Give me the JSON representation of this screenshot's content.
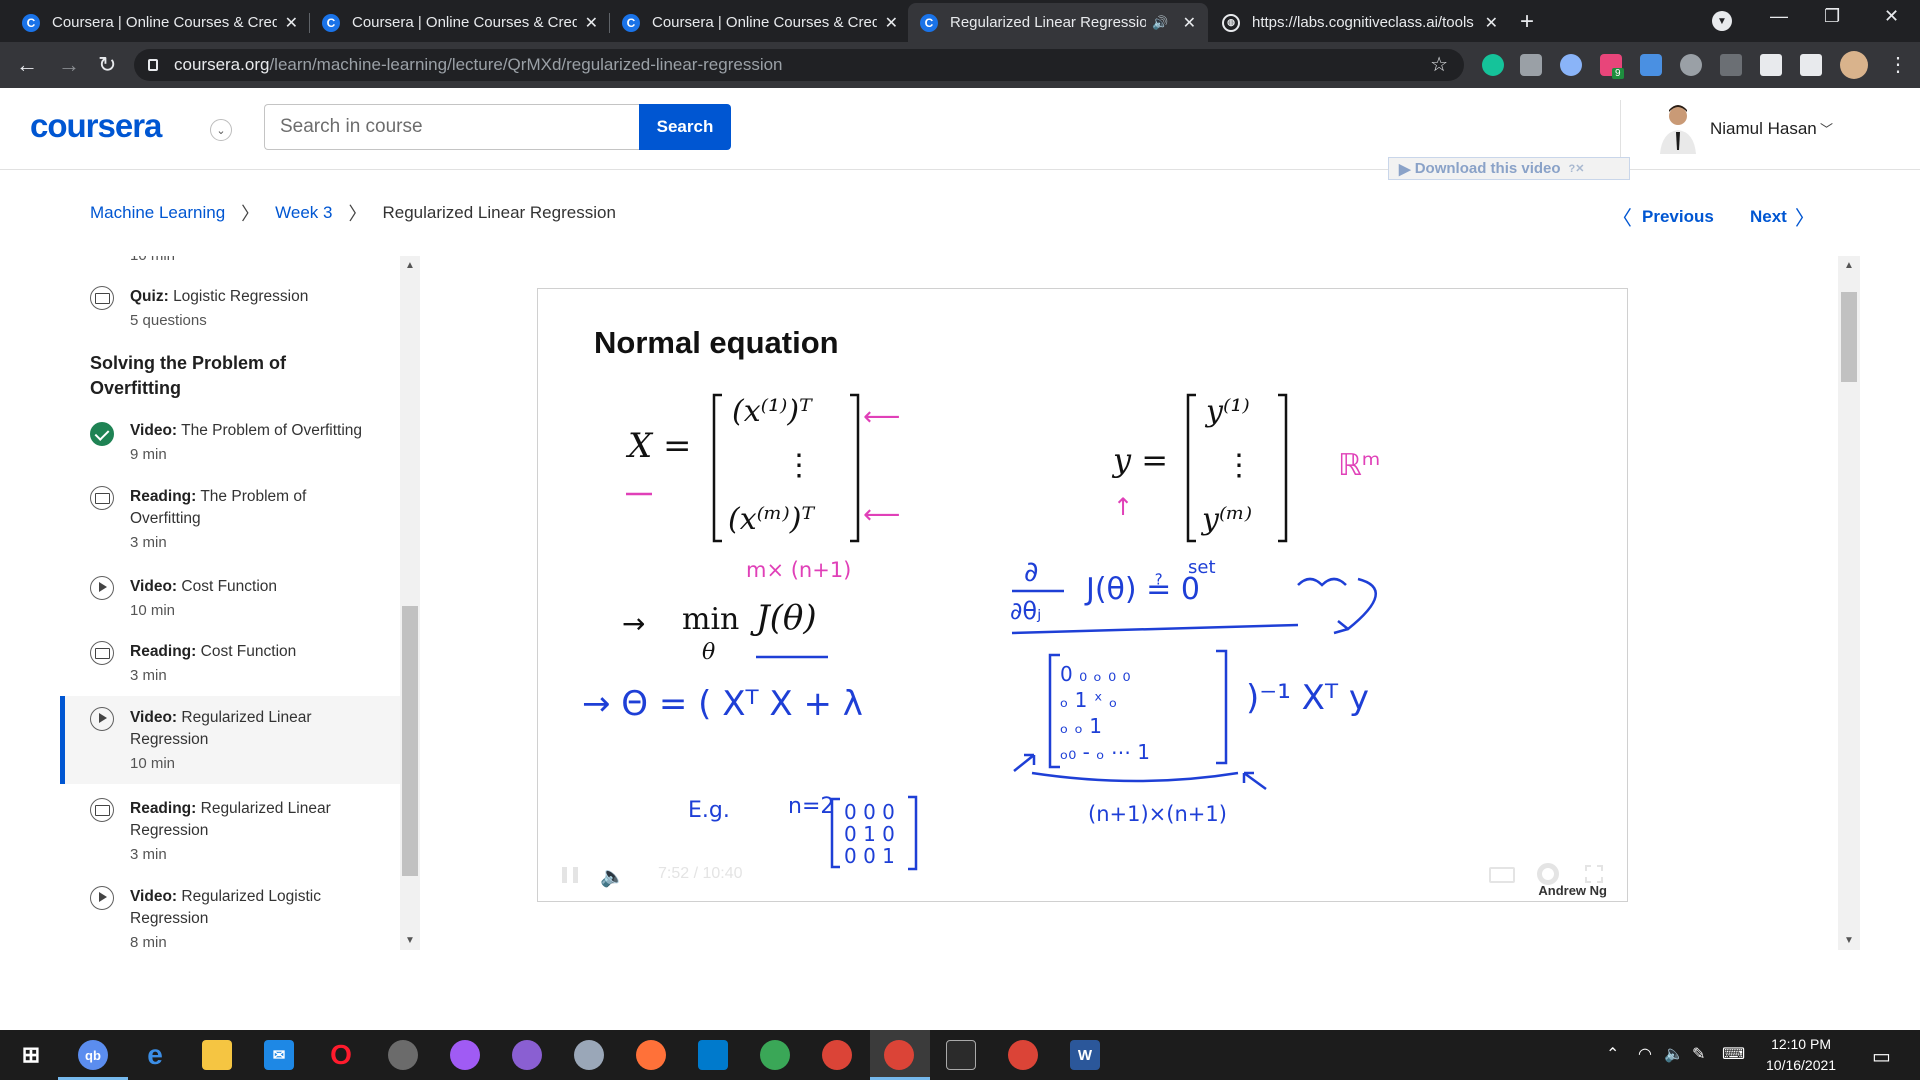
{
  "browser": {
    "tabs": [
      {
        "title": "Coursera | Online Courses & Credentials"
      },
      {
        "title": "Coursera | Online Courses & Credentials"
      },
      {
        "title": "Coursera | Online Courses & Credentials"
      },
      {
        "title": "Regularized Linear Regression"
      },
      {
        "title": "https://labs.cognitiveclass.ai/tools"
      }
    ],
    "url_host": "coursera.org",
    "url_path": "/learn/machine-learning/lecture/QrMXd/regularized-linear-regression",
    "extension_badge": "9"
  },
  "header": {
    "logo": "coursera",
    "search_placeholder": "Search in course",
    "search_button": "Search",
    "user_name": "Niamul Hasan",
    "download_widget": "Download this video"
  },
  "breadcrumb": {
    "items": [
      "Machine Learning",
      "Week 3",
      "Regularized Linear Regression"
    ]
  },
  "pager": {
    "previous": "Previous",
    "next": "Next"
  },
  "sidebar": {
    "clipped_text": "10 min",
    "section_heading": "Solving the Problem of Overfitting",
    "items": [
      {
        "type": "Quiz:",
        "title": "Logistic Regression",
        "meta": "5 questions",
        "icon": "book-icon"
      },
      {
        "type": "Video:",
        "title": "The Problem of Overfitting",
        "meta": "9 min",
        "icon": "check-icon"
      },
      {
        "type": "Reading:",
        "title": "The Problem of Overfitting",
        "meta": "3 min",
        "icon": "book-icon"
      },
      {
        "type": "Video:",
        "title": "Cost Function",
        "meta": "10 min",
        "icon": "play-icon"
      },
      {
        "type": "Reading:",
        "title": "Cost Function",
        "meta": "3 min",
        "icon": "book-icon"
      },
      {
        "type": "Video:",
        "title": "Regularized Linear Regression",
        "meta": "10 min",
        "icon": "play-icon"
      },
      {
        "type": "Reading:",
        "title": "Regularized Linear Regression",
        "meta": "3 min",
        "icon": "book-icon"
      },
      {
        "type": "Video:",
        "title": "Regularized Logistic Regression",
        "meta": "8 min",
        "icon": "play-icon"
      }
    ]
  },
  "video": {
    "slide_title": "Normal equation",
    "current_time": "7:52",
    "time_sep": "/",
    "duration": "10:40",
    "credit": "Andrew Ng",
    "annotations": {
      "dims": "m× (n+1)",
      "real": "ℝᵐ",
      "partial_num": "∂",
      "partial_den": "∂θⱼ",
      "set": "set",
      "eg": "E.g.",
      "n2": "n=2",
      "size": "(n+1)×(n+1)",
      "set_zero": "J(θ) ≟ 0"
    }
  },
  "taskbar": {
    "time": "12:10 PM",
    "date": "10/16/2021"
  },
  "colors": {
    "coursera_blue": "#0056d2",
    "annotation_pink": "#e040b8",
    "annotation_blue": "#1e3fd6"
  }
}
